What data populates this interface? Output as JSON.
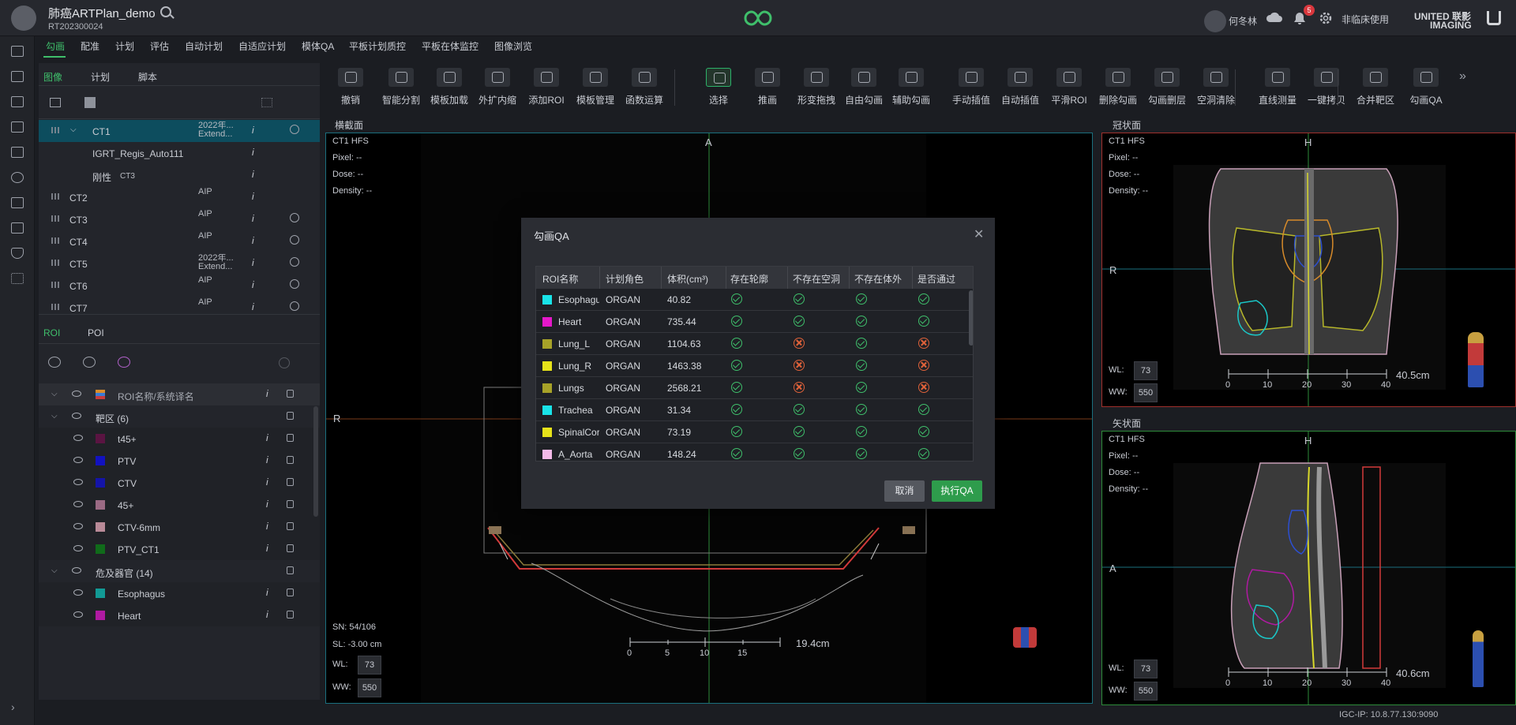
{
  "app": {
    "title": "肺癌ARTPlan_demo",
    "subtitle": "RT202300024"
  },
  "header": {
    "user": "何冬林",
    "notifications": "5",
    "mode": "非临床使用",
    "brand_line1": "UNITED 联影",
    "brand_line2": "IMAGING"
  },
  "menu": [
    "勾画",
    "配准",
    "计划",
    "评估",
    "自动计划",
    "自适应计划",
    "模体QA",
    "平板计划质控",
    "平板在体监控",
    "图像浏览"
  ],
  "left_tabs": [
    "图像",
    "计划",
    "脚本"
  ],
  "series": [
    {
      "name": "CT1",
      "sub1": "2022年...",
      "sub2": "Extend...",
      "selected": true
    },
    {
      "name": "IGRT_Regis_Auto111",
      "sub1": "",
      "sub2": ""
    },
    {
      "name": "刚性",
      "tag": "CT3",
      "sub1": "",
      "sub2": ""
    },
    {
      "name": "CT2",
      "sub1": "AIP",
      "sub2": ""
    },
    {
      "name": "CT3",
      "sub1": "AIP",
      "sub2": ""
    },
    {
      "name": "CT4",
      "sub1": "AIP",
      "sub2": ""
    },
    {
      "name": "CT5",
      "sub1": "2022年...",
      "sub2": "Extend..."
    },
    {
      "name": "CT6",
      "sub1": "AIP",
      "sub2": ""
    },
    {
      "name": "CT7",
      "sub1": "AIP",
      "sub2": ""
    }
  ],
  "roi_tabs": [
    "ROI",
    "POI"
  ],
  "roi_header": "ROI名称/系统译名",
  "roi_groups": [
    {
      "label": "靶区 (6)",
      "items": [
        {
          "name": "t45+",
          "color": "#5a1442"
        },
        {
          "name": "PTV",
          "color": "#1212c0"
        },
        {
          "name": "CTV",
          "color": "#1414a8"
        },
        {
          "name": "45+",
          "color": "#9b6a84"
        },
        {
          "name": "CTV-6mm",
          "color": "#b98a98"
        },
        {
          "name": "PTV_CT1",
          "color": "#106b1a"
        }
      ]
    },
    {
      "label": "危及器官 (14)",
      "items": [
        {
          "name": "Esophagus",
          "color": "#129a95"
        },
        {
          "name": "Heart",
          "color": "#b01aa2"
        }
      ]
    }
  ],
  "toolbar": [
    "撤销",
    "智能分割",
    "模板加载",
    "外扩内缩",
    "添加ROI",
    "模板管理",
    "函数运算",
    "选择",
    "推画",
    "形变拖拽",
    "自由勾画",
    "辅助勾画",
    "手动插值",
    "自动插值",
    "平滑ROI",
    "删除勾画",
    "勾画删层",
    "空洞清除",
    "直线测量",
    "一键拷贝",
    "合并靶区",
    "勾画QA"
  ],
  "views": {
    "axial": {
      "title": "横截面",
      "series": "CT1 HFS",
      "pixel": "Pixel:  --",
      "dose": "Dose:  --",
      "density": "Density:  --",
      "top_label": "A",
      "left_label": "R",
      "sn": "SN: 54/106",
      "sl": "SL: -3.00 cm",
      "wl_label": "WL:",
      "wl": "73",
      "ww_label": "WW:",
      "ww": "550",
      "ruler_ticks": [
        "0",
        "5",
        "10",
        "15"
      ],
      "ruler_len": "19.4cm"
    },
    "coronal": {
      "title": "冠状面",
      "series": "CT1 HFS",
      "pixel": "Pixel:  --",
      "dose": "Dose:  --",
      "density": "Density:  --",
      "top_label": "H",
      "left_label": "R",
      "wl_label": "WL:",
      "wl": "73",
      "ww_label": "WW:",
      "ww": "550",
      "ruler_ticks": [
        "0",
        "10",
        "20",
        "30",
        "40"
      ],
      "ruler_len": "40.5cm"
    },
    "sagittal": {
      "title": "矢状面",
      "series": "CT1 HFS",
      "pixel": "Pixel:  --",
      "dose": "Dose:  --",
      "density": "Density:  --",
      "top_label": "H",
      "left_label": "A",
      "wl_label": "WL:",
      "wl": "73",
      "ww_label": "WW:",
      "ww": "550",
      "ruler_ticks": [
        "0",
        "10",
        "20",
        "30",
        "40"
      ],
      "ruler_len": "40.6cm"
    }
  },
  "qa_dialog": {
    "title": "勾画QA",
    "columns": [
      "ROI名称",
      "计划角色",
      "体积(cm³)",
      "存在轮廓",
      "不存在空洞",
      "不存在体外",
      "是否通过"
    ],
    "rows": [
      {
        "name": "Esophagus",
        "role": "ORGAN",
        "volume": "40.82",
        "color": "#19e3e8",
        "checks": [
          true,
          true,
          true,
          true
        ]
      },
      {
        "name": "Heart",
        "role": "ORGAN",
        "volume": "735.44",
        "color": "#e418c9",
        "checks": [
          true,
          true,
          true,
          true
        ]
      },
      {
        "name": "Lung_L",
        "role": "ORGAN",
        "volume": "1104.63",
        "color": "#a7a228",
        "checks": [
          true,
          false,
          true,
          false
        ]
      },
      {
        "name": "Lung_R",
        "role": "ORGAN",
        "volume": "1463.38",
        "color": "#e6e21a",
        "checks": [
          true,
          false,
          true,
          false
        ]
      },
      {
        "name": "Lungs",
        "role": "ORGAN",
        "volume": "2568.21",
        "color": "#a7a228",
        "checks": [
          true,
          false,
          true,
          false
        ]
      },
      {
        "name": "Trachea",
        "role": "ORGAN",
        "volume": "31.34",
        "color": "#19e3e8",
        "checks": [
          true,
          true,
          true,
          true
        ]
      },
      {
        "name": "SpinalCord",
        "role": "ORGAN",
        "volume": "73.19",
        "color": "#e6e21a",
        "checks": [
          true,
          true,
          true,
          true
        ]
      },
      {
        "name": "A_Aorta",
        "role": "ORGAN",
        "volume": "148.24",
        "color": "#f3b9e8",
        "checks": [
          true,
          true,
          true,
          true
        ]
      }
    ],
    "cancel": "取消",
    "run": "执行QA"
  },
  "status": {
    "ip": "IGC-IP: 10.8.77.130:9090"
  }
}
